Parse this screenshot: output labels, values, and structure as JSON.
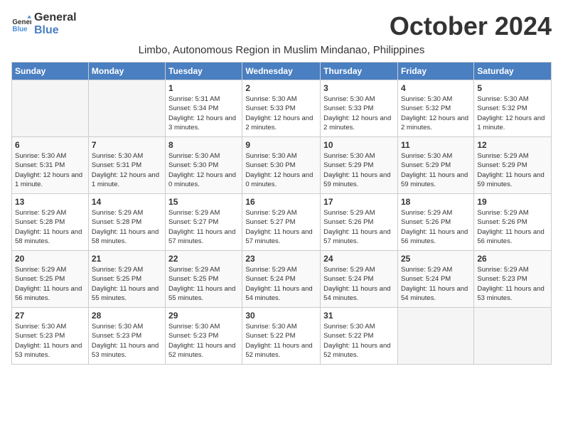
{
  "logo": {
    "line1": "General",
    "line2": "Blue"
  },
  "title": "October 2024",
  "subtitle": "Limbo, Autonomous Region in Muslim Mindanao, Philippines",
  "weekdays": [
    "Sunday",
    "Monday",
    "Tuesday",
    "Wednesday",
    "Thursday",
    "Friday",
    "Saturday"
  ],
  "weeks": [
    [
      {
        "day": "",
        "info": ""
      },
      {
        "day": "",
        "info": ""
      },
      {
        "day": "1",
        "info": "Sunrise: 5:31 AM\nSunset: 5:34 PM\nDaylight: 12 hours and 3 minutes."
      },
      {
        "day": "2",
        "info": "Sunrise: 5:30 AM\nSunset: 5:33 PM\nDaylight: 12 hours and 2 minutes."
      },
      {
        "day": "3",
        "info": "Sunrise: 5:30 AM\nSunset: 5:33 PM\nDaylight: 12 hours and 2 minutes."
      },
      {
        "day": "4",
        "info": "Sunrise: 5:30 AM\nSunset: 5:32 PM\nDaylight: 12 hours and 2 minutes."
      },
      {
        "day": "5",
        "info": "Sunrise: 5:30 AM\nSunset: 5:32 PM\nDaylight: 12 hours and 1 minute."
      }
    ],
    [
      {
        "day": "6",
        "info": "Sunrise: 5:30 AM\nSunset: 5:31 PM\nDaylight: 12 hours and 1 minute."
      },
      {
        "day": "7",
        "info": "Sunrise: 5:30 AM\nSunset: 5:31 PM\nDaylight: 12 hours and 1 minute."
      },
      {
        "day": "8",
        "info": "Sunrise: 5:30 AM\nSunset: 5:30 PM\nDaylight: 12 hours and 0 minutes."
      },
      {
        "day": "9",
        "info": "Sunrise: 5:30 AM\nSunset: 5:30 PM\nDaylight: 12 hours and 0 minutes."
      },
      {
        "day": "10",
        "info": "Sunrise: 5:30 AM\nSunset: 5:29 PM\nDaylight: 11 hours and 59 minutes."
      },
      {
        "day": "11",
        "info": "Sunrise: 5:30 AM\nSunset: 5:29 PM\nDaylight: 11 hours and 59 minutes."
      },
      {
        "day": "12",
        "info": "Sunrise: 5:29 AM\nSunset: 5:29 PM\nDaylight: 11 hours and 59 minutes."
      }
    ],
    [
      {
        "day": "13",
        "info": "Sunrise: 5:29 AM\nSunset: 5:28 PM\nDaylight: 11 hours and 58 minutes."
      },
      {
        "day": "14",
        "info": "Sunrise: 5:29 AM\nSunset: 5:28 PM\nDaylight: 11 hours and 58 minutes."
      },
      {
        "day": "15",
        "info": "Sunrise: 5:29 AM\nSunset: 5:27 PM\nDaylight: 11 hours and 57 minutes."
      },
      {
        "day": "16",
        "info": "Sunrise: 5:29 AM\nSunset: 5:27 PM\nDaylight: 11 hours and 57 minutes."
      },
      {
        "day": "17",
        "info": "Sunrise: 5:29 AM\nSunset: 5:26 PM\nDaylight: 11 hours and 57 minutes."
      },
      {
        "day": "18",
        "info": "Sunrise: 5:29 AM\nSunset: 5:26 PM\nDaylight: 11 hours and 56 minutes."
      },
      {
        "day": "19",
        "info": "Sunrise: 5:29 AM\nSunset: 5:26 PM\nDaylight: 11 hours and 56 minutes."
      }
    ],
    [
      {
        "day": "20",
        "info": "Sunrise: 5:29 AM\nSunset: 5:25 PM\nDaylight: 11 hours and 56 minutes."
      },
      {
        "day": "21",
        "info": "Sunrise: 5:29 AM\nSunset: 5:25 PM\nDaylight: 11 hours and 55 minutes."
      },
      {
        "day": "22",
        "info": "Sunrise: 5:29 AM\nSunset: 5:25 PM\nDaylight: 11 hours and 55 minutes."
      },
      {
        "day": "23",
        "info": "Sunrise: 5:29 AM\nSunset: 5:24 PM\nDaylight: 11 hours and 54 minutes."
      },
      {
        "day": "24",
        "info": "Sunrise: 5:29 AM\nSunset: 5:24 PM\nDaylight: 11 hours and 54 minutes."
      },
      {
        "day": "25",
        "info": "Sunrise: 5:29 AM\nSunset: 5:24 PM\nDaylight: 11 hours and 54 minutes."
      },
      {
        "day": "26",
        "info": "Sunrise: 5:29 AM\nSunset: 5:23 PM\nDaylight: 11 hours and 53 minutes."
      }
    ],
    [
      {
        "day": "27",
        "info": "Sunrise: 5:30 AM\nSunset: 5:23 PM\nDaylight: 11 hours and 53 minutes."
      },
      {
        "day": "28",
        "info": "Sunrise: 5:30 AM\nSunset: 5:23 PM\nDaylight: 11 hours and 53 minutes."
      },
      {
        "day": "29",
        "info": "Sunrise: 5:30 AM\nSunset: 5:23 PM\nDaylight: 11 hours and 52 minutes."
      },
      {
        "day": "30",
        "info": "Sunrise: 5:30 AM\nSunset: 5:22 PM\nDaylight: 11 hours and 52 minutes."
      },
      {
        "day": "31",
        "info": "Sunrise: 5:30 AM\nSunset: 5:22 PM\nDaylight: 11 hours and 52 minutes."
      },
      {
        "day": "",
        "info": ""
      },
      {
        "day": "",
        "info": ""
      }
    ]
  ]
}
